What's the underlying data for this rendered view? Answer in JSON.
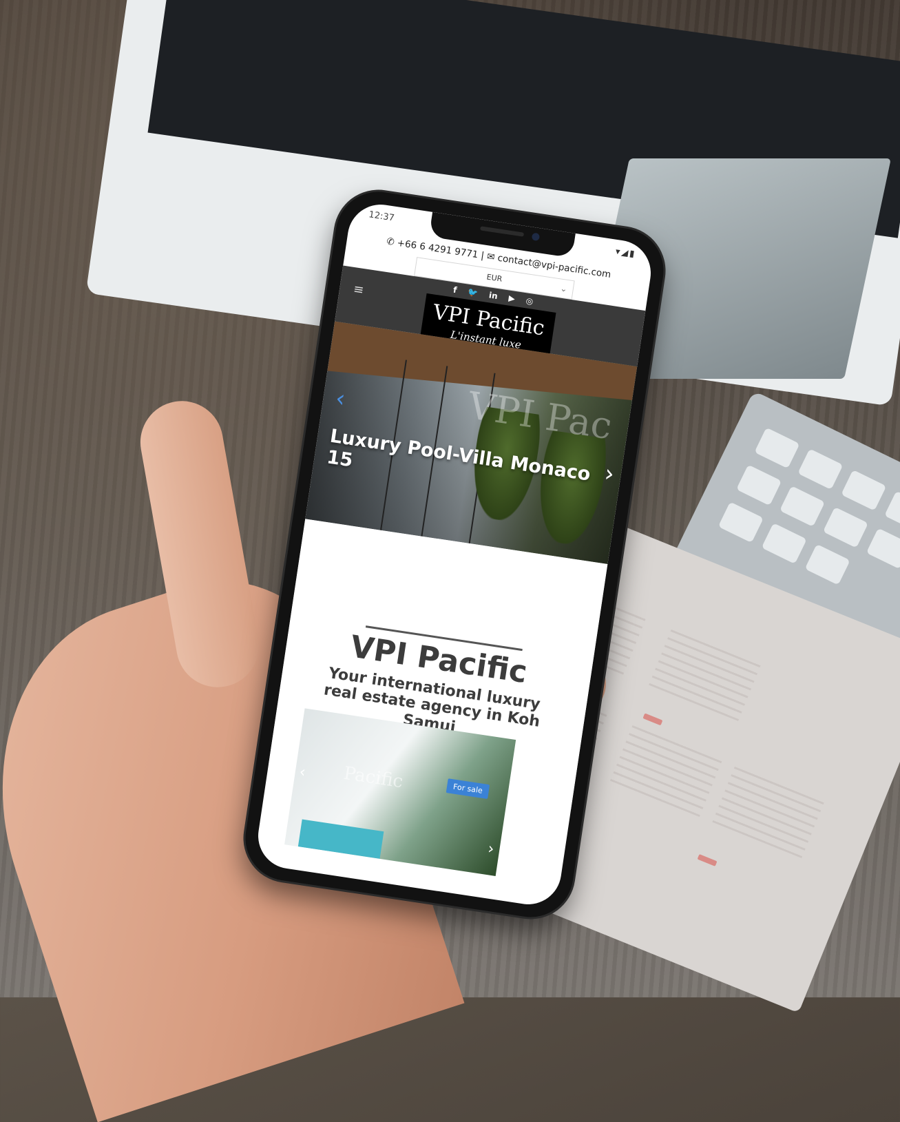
{
  "status": {
    "time": "12:37",
    "icons": "▾◢▮"
  },
  "contact": {
    "phone": "+66 6 4291 9771",
    "separator": "|",
    "email": "contact@vpi-pacific.com"
  },
  "currency": {
    "selected": "EUR"
  },
  "socials": [
    {
      "icon": "facebook-icon",
      "glyph": "f"
    },
    {
      "icon": "twitter-icon",
      "glyph": "🐦"
    },
    {
      "icon": "linkedin-icon",
      "glyph": "in"
    },
    {
      "icon": "youtube-icon",
      "glyph": "▶"
    },
    {
      "icon": "instagram-icon",
      "glyph": "◎"
    }
  ],
  "logo": {
    "title": "VPI Pacific",
    "tagline": "L'instant luxe"
  },
  "hero": {
    "title": "Luxury Pool-Villa Monaco 15",
    "watermark": "VPI Pac"
  },
  "about": {
    "title": "VPI Pacific",
    "subtitle": "Your international luxury real estate agency in Koh Samui"
  },
  "listing": {
    "badge": "For sale",
    "watermark": "Pacific"
  },
  "colors": {
    "accent": "#3b82d6",
    "header": "#3a3a3a"
  }
}
